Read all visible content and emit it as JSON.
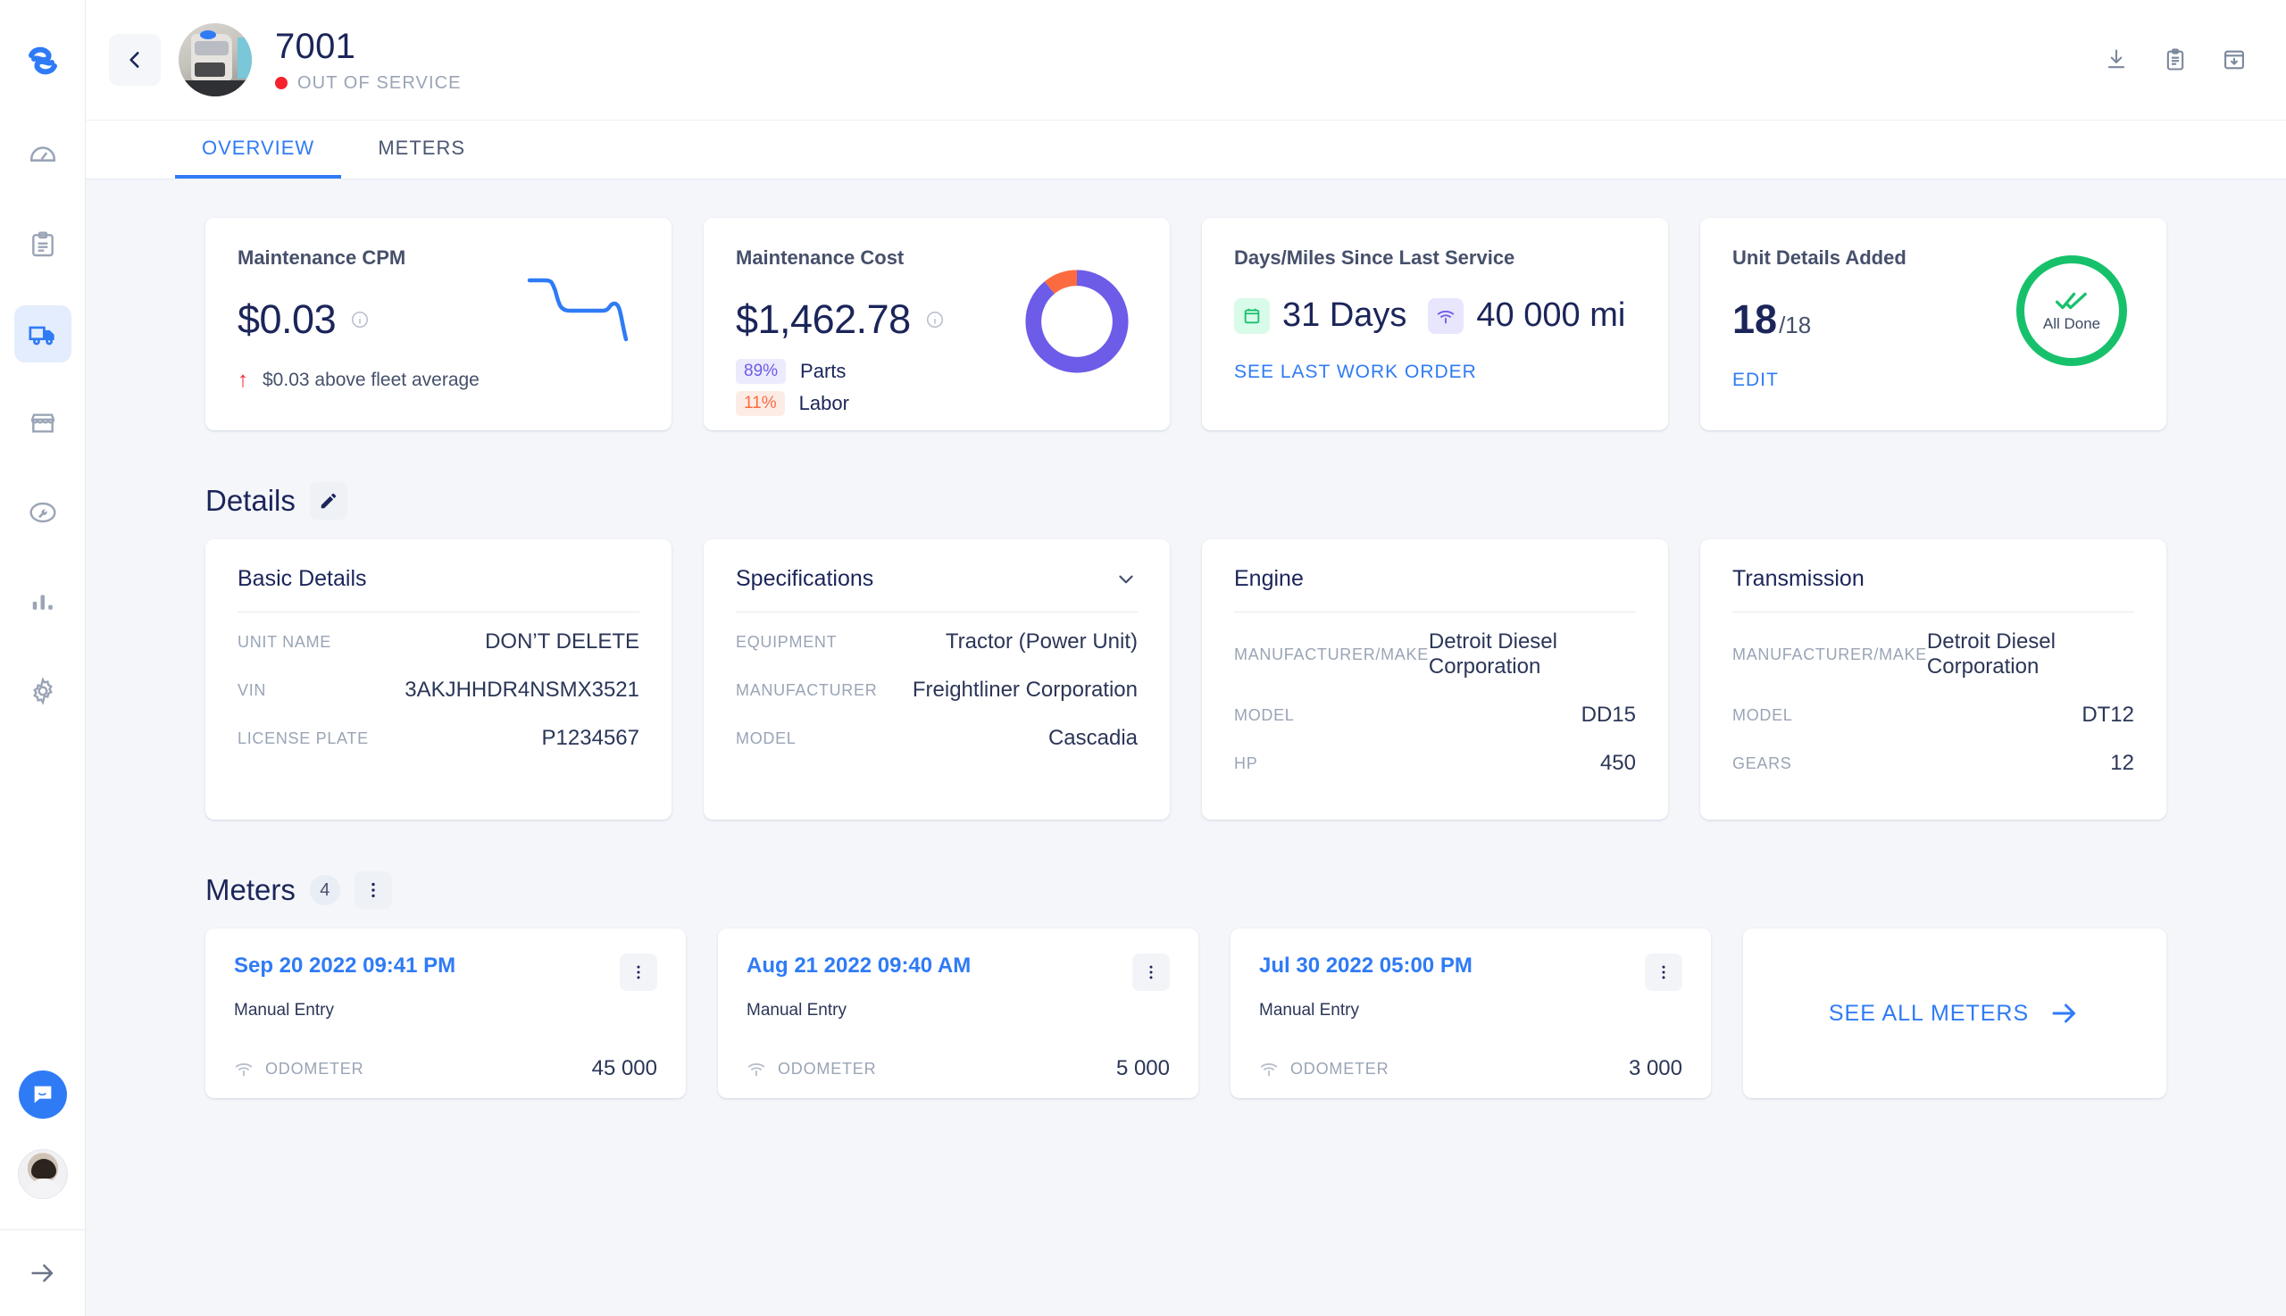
{
  "sidebar": {
    "logo": "fleetio-logo-icon",
    "items": [
      {
        "name": "dashboard",
        "icon": "gauge-icon",
        "active": false
      },
      {
        "name": "inspections",
        "icon": "clipboard-icon",
        "active": false
      },
      {
        "name": "vehicles",
        "icon": "truck-icon",
        "active": true
      },
      {
        "name": "vendors",
        "icon": "storefront-icon",
        "active": false
      },
      {
        "name": "service",
        "icon": "wrench-circle-icon",
        "active": false
      },
      {
        "name": "reports",
        "icon": "bar-chart-icon",
        "active": false
      },
      {
        "name": "settings",
        "icon": "gear-icon",
        "active": false
      }
    ],
    "intercom": "chat-bubble-icon",
    "avatar": "user-avatar",
    "expand": "arrow-right-icon"
  },
  "header": {
    "back": "chevron-left-icon",
    "unit_photo": "truck-photo",
    "title": "7001",
    "status": "OUT OF SERVICE",
    "status_color": "#f5222d",
    "actions": [
      {
        "name": "download-icon"
      },
      {
        "name": "clipboard-icon"
      },
      {
        "name": "archive-icon"
      }
    ]
  },
  "tabs": [
    {
      "label": "OVERVIEW",
      "active": true
    },
    {
      "label": "METERS",
      "active": false
    }
  ],
  "kpis": {
    "cpm": {
      "title": "Maintenance CPM",
      "value": "$0.03",
      "info": "info-icon",
      "delta_arrow": "↑",
      "delta_text": "$0.03 above fleet average",
      "delta_color": "#f5222d"
    },
    "cost": {
      "title": "Maintenance Cost",
      "value": "$1,462.78",
      "info": "info-icon",
      "parts_pct": "89%",
      "parts_label": "Parts",
      "labor_pct": "11%",
      "labor_label": "Labor",
      "parts_color": "#6c5ce7",
      "labor_color": "#fb6b3f"
    },
    "service": {
      "title": "Days/Miles Since Last Service",
      "days": "31 Days",
      "miles": "40 000 mi",
      "link": "SEE LAST WORK ORDER"
    },
    "details_added": {
      "title": "Unit Details Added",
      "value": "18",
      "total": "/18",
      "link": "EDIT",
      "ring_label": "All Done",
      "ring_color": "#17c16b"
    }
  },
  "chart_data": [
    {
      "type": "line",
      "title": "Maintenance CPM trend",
      "name": "cpm-sparkline",
      "x": [
        0,
        1,
        2,
        3,
        4,
        5,
        6,
        7
      ],
      "values": [
        0.062,
        0.062,
        0.064,
        0.03,
        0.03,
        0.03,
        0.034,
        0.0
      ],
      "ylim": [
        0,
        0.07
      ],
      "grid": false,
      "color": "#2f7bf6"
    },
    {
      "type": "pie",
      "title": "Maintenance Cost breakdown",
      "name": "cost-donut",
      "categories": [
        "Parts",
        "Labor"
      ],
      "values": [
        89,
        11
      ],
      "colors": [
        "#6c5ce7",
        "#fb6b3f"
      ],
      "legend": "left"
    }
  ],
  "details": {
    "heading": "Details",
    "edit_icon": "pencil-icon",
    "cards": [
      {
        "title": "Basic Details",
        "collapsible": false,
        "rows": [
          {
            "k": "UNIT NAME",
            "v": "DON’T DELETE"
          },
          {
            "k": "VIN",
            "v": "3AKJHHDR4NSMX3521"
          },
          {
            "k": "LICENSE PLATE",
            "v": "P1234567"
          }
        ]
      },
      {
        "title": "Specifications",
        "collapsible": true,
        "rows": [
          {
            "k": "EQUIPMENT",
            "v": "Tractor (Power Unit)"
          },
          {
            "k": "MANUFACTURER",
            "v": "Freightliner Corporation"
          },
          {
            "k": "MODEL",
            "v": "Cascadia"
          }
        ]
      },
      {
        "title": "Engine",
        "collapsible": false,
        "rows": [
          {
            "k": "MANUFACTURER/MAKE",
            "v": "Detroit Diesel Corporation"
          },
          {
            "k": "MODEL",
            "v": "DD15"
          },
          {
            "k": "HP",
            "v": "450"
          }
        ]
      },
      {
        "title": "Transmission",
        "collapsible": false,
        "rows": [
          {
            "k": "MANUFACTURER/MAKE",
            "v": "Detroit Diesel Corporation"
          },
          {
            "k": "MODEL",
            "v": "DT12"
          },
          {
            "k": "GEARS",
            "v": "12"
          }
        ]
      }
    ]
  },
  "meters": {
    "heading": "Meters",
    "count": "4",
    "menu_icon": "kebab-icon",
    "cards": [
      {
        "date": "Sep 20 2022 09:41 PM",
        "source": "Manual Entry",
        "meter_label": "ODOMETER",
        "meter_value": "45 000"
      },
      {
        "date": "Aug 21 2022 09:40 AM",
        "source": "Manual Entry",
        "meter_label": "ODOMETER",
        "meter_value": "5 000"
      },
      {
        "date": "Jul 30 2022 05:00 PM",
        "source": "Manual Entry",
        "meter_label": "ODOMETER",
        "meter_value": "3 000"
      }
    ],
    "see_all": "SEE ALL METERS"
  }
}
